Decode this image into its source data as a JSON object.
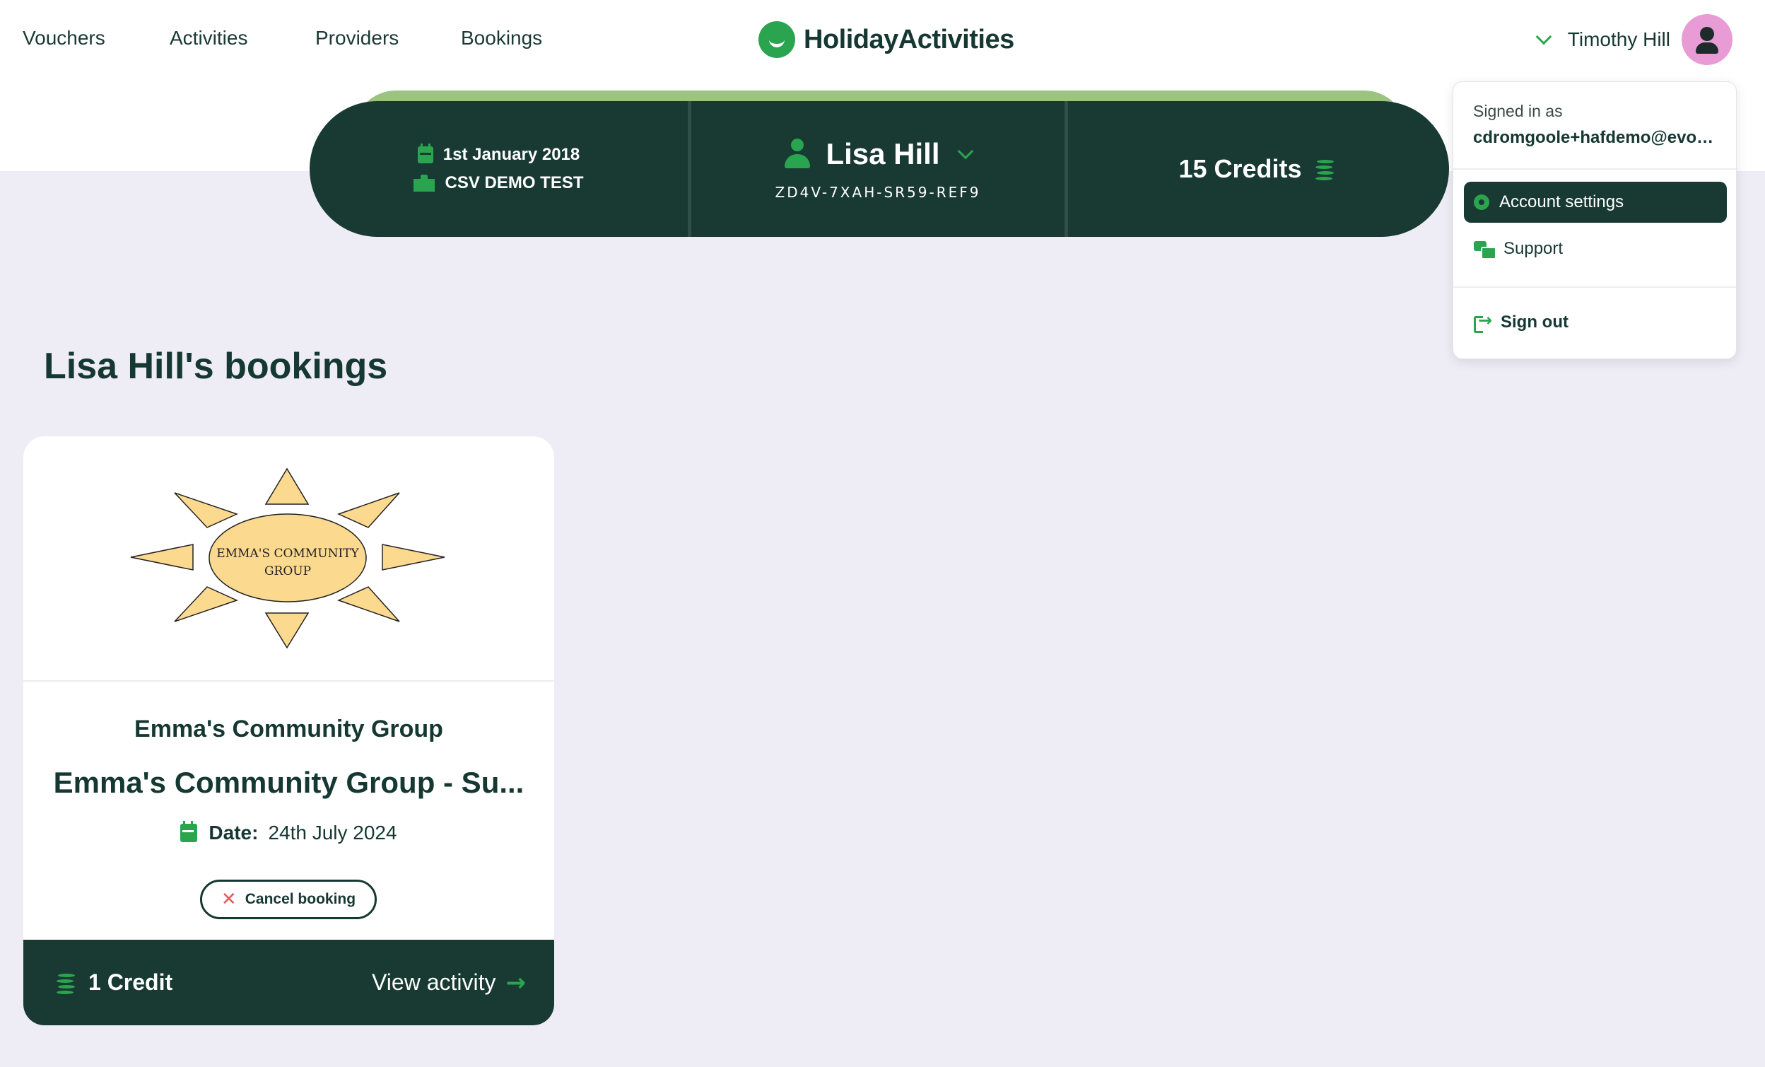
{
  "nav": {
    "links": [
      "Vouchers",
      "Activities",
      "Providers",
      "Bookings"
    ],
    "logo_text": "HolidayActivities",
    "user_name": "Timothy Hill"
  },
  "summary": {
    "date": "1st January 2018",
    "school": "CSV DEMO TEST",
    "child_name": "Lisa Hill",
    "voucher_code": "ZD4V-7XAH-SR59-REF9",
    "credits": "15 Credits"
  },
  "user_dropdown": {
    "signed_in_label": "Signed in as",
    "email": "cdromgoole+hafdemo@evou...",
    "items": [
      {
        "label": "Account settings",
        "icon": "gear-icon",
        "active": true
      },
      {
        "label": "Support",
        "icon": "support-chat-icon",
        "active": false
      },
      {
        "label": "Sign out",
        "icon": "sign-out-icon",
        "active": false
      }
    ]
  },
  "page": {
    "title": "Lisa Hill's bookings"
  },
  "booking_card": {
    "image_text_line1": "EMMA'S COMMUNITY",
    "image_text_line2": "GROUP",
    "organisation": "Emma's Community Group",
    "activity_title": "Emma's Community Group - Su...",
    "date_label": "Date:",
    "date_value": "24th July 2024",
    "cancel_label": "Cancel booking",
    "credit_cost": "1 Credit",
    "view_label": "View activity"
  },
  "colors": {
    "brand_green": "#2aa44f",
    "dark_green": "#183a33",
    "accent_light_green": "#9dc383",
    "page_bg": "#eeedf5",
    "avatar_pink": "#e89bd4"
  }
}
